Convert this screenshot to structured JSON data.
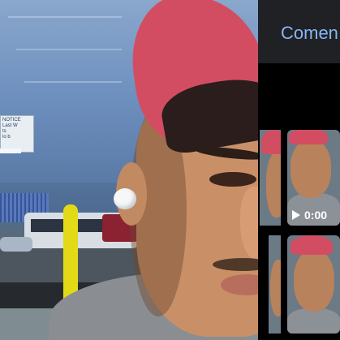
{
  "panel": {
    "title": "Comen"
  },
  "media": {
    "items": [
      {
        "type": "photo"
      },
      {
        "type": "video",
        "duration": "0:00"
      },
      {
        "type": "photo"
      },
      {
        "type": "photo"
      }
    ]
  },
  "scene": {
    "sign_text": "NOTICE Last W... ts ... lo b..."
  },
  "colors": {
    "accent": "#8ab4f8",
    "topbar": "#202124",
    "cap": "#d34d62"
  }
}
